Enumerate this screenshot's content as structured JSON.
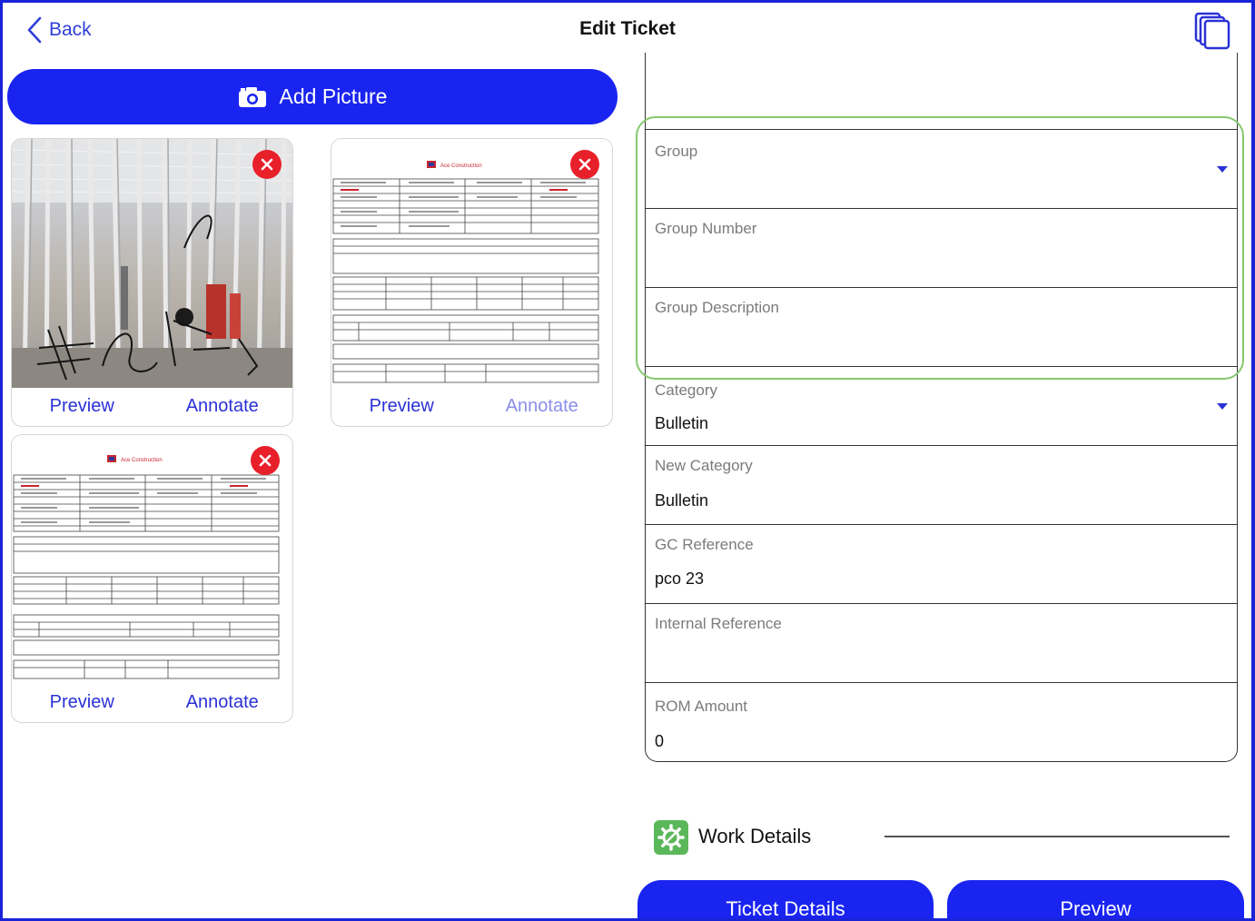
{
  "header": {
    "back_label": "Back",
    "title": "Edit Ticket"
  },
  "pictures": {
    "add_label": "Add Picture",
    "cards": [
      {
        "preview": "Preview",
        "annotate": "Annotate"
      },
      {
        "preview": "Preview",
        "annotate": "Annotate"
      },
      {
        "preview": "Preview",
        "annotate": "Annotate"
      }
    ],
    "doc_brand": "Ace Construction"
  },
  "form": {
    "group": {
      "label": "Group",
      "value": ""
    },
    "group_number": {
      "label": "Group Number",
      "value": ""
    },
    "group_description": {
      "label": "Group Description",
      "value": ""
    },
    "category": {
      "label": "Category",
      "value": "Bulletin"
    },
    "new_category": {
      "label": "New Category",
      "value": "Bulletin"
    },
    "gc_reference": {
      "label": "GC Reference",
      "value": "pco 23"
    },
    "internal_reference": {
      "label": "Internal Reference",
      "value": ""
    },
    "rom_amount": {
      "label": "ROM Amount",
      "value": "0"
    }
  },
  "work_details": {
    "label": "Work Details"
  },
  "bottom_bar": {
    "ticket_details_label": "Ticket Details",
    "preview_label": "Preview"
  },
  "colors": {
    "primary": "#1a24f0",
    "link": "#2a32d6",
    "danger": "#e8202a",
    "highlight": "#86c96d",
    "work_icon": "#5bb85a"
  }
}
